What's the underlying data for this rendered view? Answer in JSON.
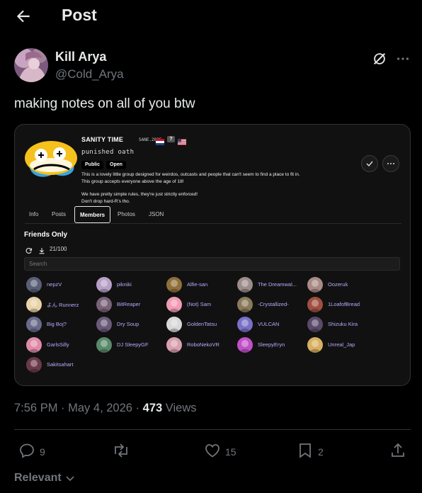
{
  "header": {
    "title": "Post",
    "back_icon": "arrow-left-icon"
  },
  "author": {
    "display_name": "Kill Arya",
    "handle": "@Cold_Arya"
  },
  "post": {
    "text": "making notes on all of you btw"
  },
  "screenshot": {
    "group_name": "SANITY TIME",
    "group_tag": "SANE.2825",
    "badge_unknown": "?",
    "motto": "punished oath",
    "badges": [
      "Public",
      "Open"
    ],
    "description": [
      "This is a lovely little group designed for weirdos, outcasts and people that can't seem to find a place to fit in.",
      "This group accepts everyone above the age of 18!",
      "We have pretty simple rules, they're just strictly enforced!",
      "Don't drop hard-R's tho."
    ],
    "tabs": [
      "Info",
      "Posts",
      "Members",
      "Photos",
      "JSON"
    ],
    "active_tab": "Members",
    "section_title": "Friends Only",
    "member_count": "21/100",
    "search_placeholder": "Search",
    "members": [
      "nepzV",
      "pikniki",
      "Alfie-san",
      "The Dreamwal...",
      "Oozeruk",
      "よん Runnerz",
      "BitReaper",
      "(Not) Sam",
      "-Crystallized-",
      "1LoafofBread",
      "Big Boj?",
      "Dry Soup",
      "GoldenTatsu",
      "VULCAN",
      "Shizuku Kira",
      "GarlsSilly",
      "DJ SleepyGF",
      "RoboNekoVR",
      "SleepyEryn",
      "Unreal_Jap",
      "Sakitsahart"
    ],
    "member_avatar_colors": [
      "#5a5f78",
      "#b7a0c8",
      "#8f6f3a",
      "#9c8d8a",
      "#a88a86",
      "#e8d2a8",
      "#7a6278",
      "#f19bb4",
      "#8a7a5a",
      "#a05040",
      "#6a6a8a",
      "#6a5a7a",
      "#d8d8d8",
      "#7a70c8",
      "#5a4a6a",
      "#e08aa8",
      "#5a8a6a",
      "#d8a0b0",
      "#c050c8",
      "#d8b060",
      "#6a3a4a"
    ]
  },
  "meta": {
    "time": "7:56 PM",
    "date": "May 4, 2026",
    "views": "473",
    "views_label": "Views"
  },
  "actions": {
    "replies": "9",
    "reposts": "",
    "likes": "15",
    "bookmarks": "2"
  },
  "sort": {
    "label": "Relevant"
  },
  "colors": {
    "background": "#000000",
    "text": "#e7e9ea",
    "muted": "#71767b",
    "member_name": "#b8aaff"
  }
}
